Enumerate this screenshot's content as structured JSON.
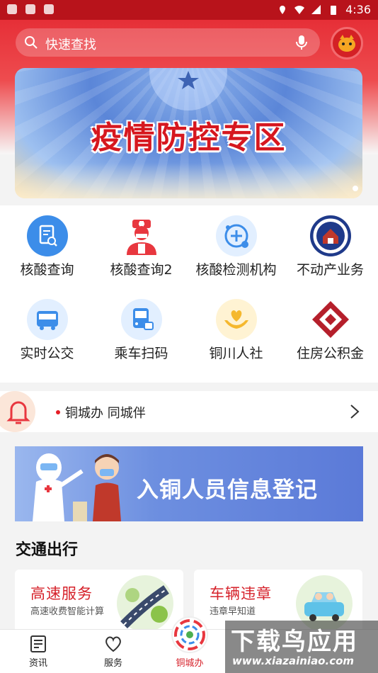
{
  "status_bar": {
    "time": "4:36"
  },
  "search": {
    "placeholder": "快速查找"
  },
  "banner": {
    "title": "疫情防控专区"
  },
  "services": [
    {
      "label": "核酸查询"
    },
    {
      "label": "核酸查询2"
    },
    {
      "label": "核酸检测机构"
    },
    {
      "label": "不动产业务"
    },
    {
      "label": "实时公交"
    },
    {
      "label": "乘车扫码"
    },
    {
      "label": "铜川人社"
    },
    {
      "label": "住房公积金"
    }
  ],
  "notice": {
    "text": "铜城办 同城伴"
  },
  "registration_banner": {
    "title": "入铜人员信息登记"
  },
  "transport": {
    "section_title": "交通出行",
    "cards": [
      {
        "title": "高速服务",
        "subtitle": "高速收费智能计算"
      },
      {
        "title": "车辆违章",
        "subtitle": "违章早知道"
      }
    ]
  },
  "tabbar": {
    "tabs": [
      {
        "label": "资讯"
      },
      {
        "label": "服务"
      },
      {
        "label": "铜城办"
      }
    ]
  },
  "watermark": {
    "big": "下载鸟应用",
    "small": "www.xiazainiao.com"
  },
  "colors": {
    "primary": "#e62f37",
    "accent_text": "#d6212a",
    "icon_blue": "#3c8de9"
  }
}
